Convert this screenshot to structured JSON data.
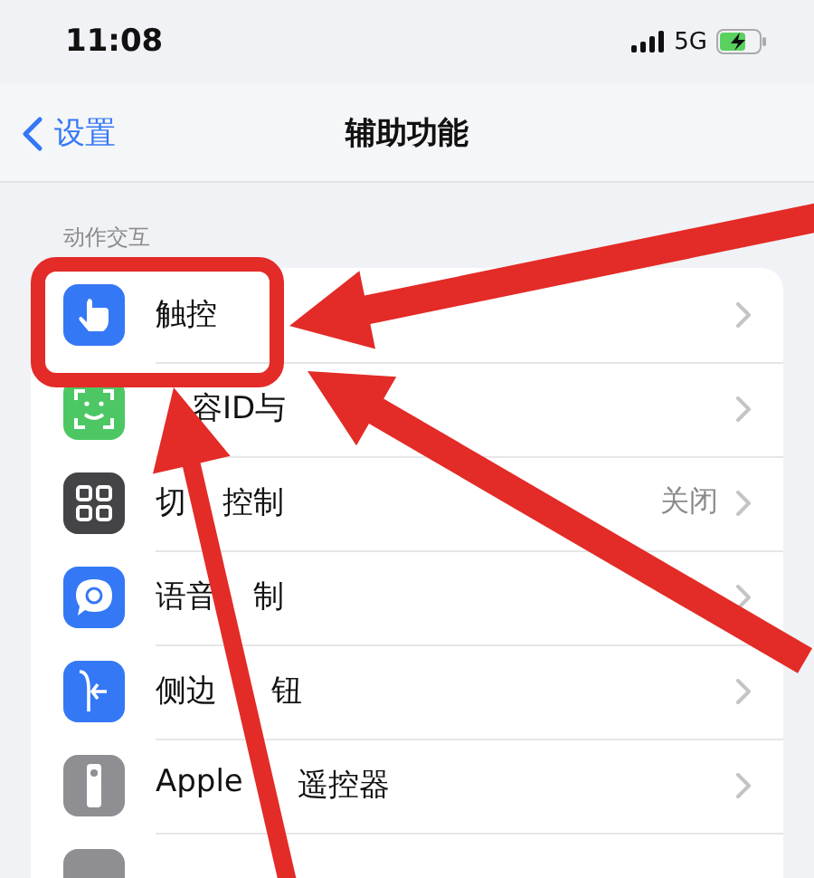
{
  "status_bar": {
    "time": "11:08",
    "network": "5G"
  },
  "nav": {
    "back": "设置",
    "title": "辅助功能"
  },
  "section": {
    "header": "动作交互"
  },
  "rows": [
    {
      "label_parts": [
        "触控"
      ]
    },
    {
      "label_parts": [
        "容ID与"
      ]
    },
    {
      "label_parts": [
        "切",
        "控制"
      ],
      "value": "关闭"
    },
    {
      "label_parts": [
        "语音",
        "制"
      ]
    },
    {
      "label_parts": [
        "侧边",
        "钮"
      ]
    },
    {
      "label_parts": [
        "Apple",
        "遥控器"
      ]
    }
  ]
}
